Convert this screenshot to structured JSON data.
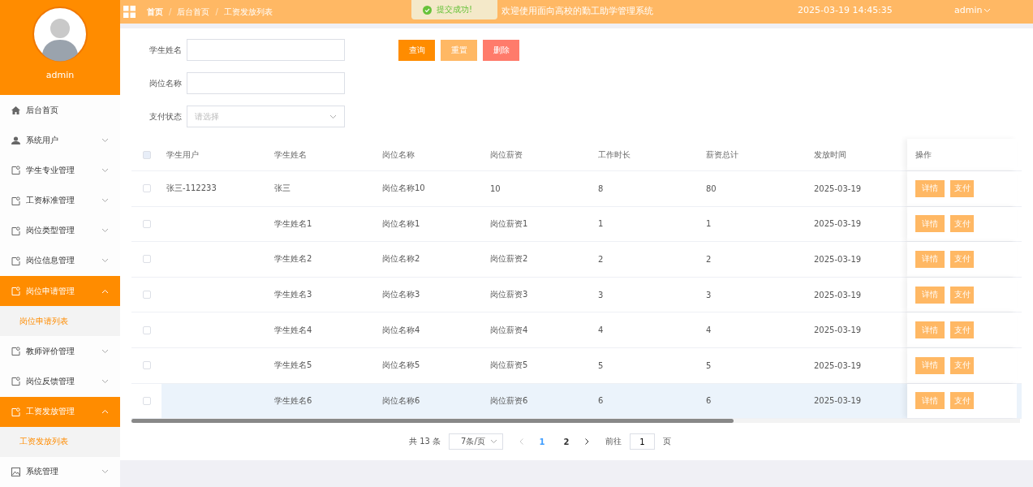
{
  "header": {
    "breadcrumb": [
      "首页",
      "后台首页",
      "工资发放列表"
    ],
    "separator": "/",
    "title": "欢迎使用面向高校的勤工助学管理系统",
    "datetime": "2025-03-19 14:45:35",
    "user": "admin"
  },
  "toast": {
    "kind": "success",
    "message": "提交成功!"
  },
  "sidebar": {
    "user": "admin",
    "items": [
      {
        "label": "后台首页",
        "kind": "home",
        "expanded": false
      },
      {
        "label": "系统用户",
        "kind": "user",
        "expanded": false
      },
      {
        "label": "学生专业管理",
        "kind": "doc",
        "expanded": false
      },
      {
        "label": "工资标准管理",
        "kind": "doc",
        "expanded": false
      },
      {
        "label": "岗位类型管理",
        "kind": "doc",
        "expanded": false
      },
      {
        "label": "岗位信息管理",
        "kind": "doc",
        "expanded": false
      },
      {
        "label": "岗位申请管理",
        "kind": "doc",
        "expanded": true,
        "children": [
          {
            "label": "岗位申请列表"
          }
        ]
      },
      {
        "label": "教师评价管理",
        "kind": "doc",
        "expanded": false
      },
      {
        "label": "岗位反馈管理",
        "kind": "doc",
        "expanded": false
      },
      {
        "label": "工资发放管理",
        "kind": "doc",
        "expanded": true,
        "children": [
          {
            "label": "工资发放列表"
          }
        ]
      },
      {
        "label": "系统管理",
        "kind": "image",
        "expanded": false
      }
    ]
  },
  "filters": [
    {
      "label": "学生姓名",
      "kind": "text"
    },
    {
      "label": "岗位名称",
      "kind": "text"
    },
    {
      "label": "支付状态",
      "kind": "select",
      "placeholder": "请选择"
    }
  ],
  "buttons": [
    {
      "label": "查询",
      "kind": "primary"
    },
    {
      "label": "重置",
      "kind": "warning"
    },
    {
      "label": "删除",
      "kind": "danger"
    }
  ],
  "table": {
    "header_checked": false,
    "columns": [
      "学生用户",
      "学生姓名",
      "岗位名称",
      "岗位薪资",
      "工作时长",
      "薪资总计",
      "发放时间",
      "操作"
    ],
    "rows": [
      {
        "checked": false,
        "hovered": false,
        "cells": [
          "张三-112233",
          "张三",
          "岗位名称10",
          "10",
          "8",
          "80",
          "2025-03-19"
        ],
        "actions": [
          "详情",
          "支付"
        ]
      },
      {
        "checked": false,
        "hovered": false,
        "cells": [
          "",
          "学生姓名1",
          "岗位名称1",
          "岗位薪资1",
          "1",
          "1",
          "2025-03-19"
        ],
        "actions": [
          "详情",
          "支付"
        ]
      },
      {
        "checked": false,
        "hovered": false,
        "cells": [
          "",
          "学生姓名2",
          "岗位名称2",
          "岗位薪资2",
          "2",
          "2",
          "2025-03-19"
        ],
        "actions": [
          "详情",
          "支付"
        ]
      },
      {
        "checked": false,
        "hovered": false,
        "cells": [
          "",
          "学生姓名3",
          "岗位名称3",
          "岗位薪资3",
          "3",
          "3",
          "2025-03-19"
        ],
        "actions": [
          "详情",
          "支付"
        ]
      },
      {
        "checked": false,
        "hovered": false,
        "cells": [
          "",
          "学生姓名4",
          "岗位名称4",
          "岗位薪资4",
          "4",
          "4",
          "2025-03-19"
        ],
        "actions": [
          "详情",
          "支付"
        ]
      },
      {
        "checked": false,
        "hovered": false,
        "cells": [
          "",
          "学生姓名5",
          "岗位名称5",
          "岗位薪资5",
          "5",
          "5",
          "2025-03-19"
        ],
        "actions": [
          "详情",
          "支付"
        ]
      },
      {
        "checked": false,
        "hovered": true,
        "cells": [
          "",
          "学生姓名6",
          "岗位名称6",
          "岗位薪资6",
          "6",
          "6",
          "2025-03-19"
        ],
        "actions": [
          "详情",
          "支付"
        ]
      }
    ]
  },
  "pagination": {
    "total": "共 13 条",
    "page_size": "7条/页",
    "pages": [
      {
        "label": "1",
        "selected": true
      },
      {
        "label": "2",
        "selected": false
      }
    ],
    "goto_label": "前往",
    "goto_value": "1",
    "goto_suffix": "页"
  }
}
